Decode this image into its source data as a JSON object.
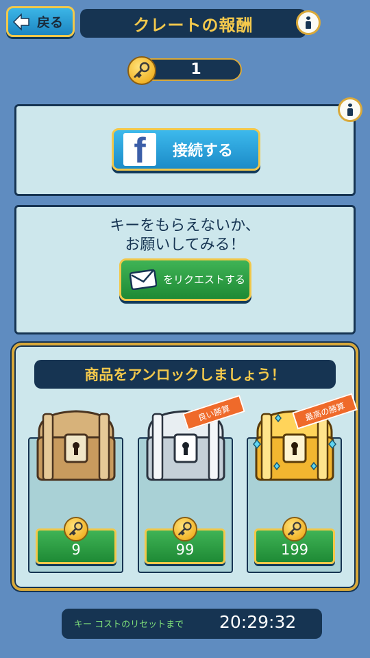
{
  "header": {
    "back_label": "戻る",
    "title": "クレートの報酬",
    "info_icon": "info-icon"
  },
  "keys": {
    "count": "1",
    "icon": "key-icon"
  },
  "facebook": {
    "connect_label": "接続する",
    "icon": "facebook-icon"
  },
  "request": {
    "message_line1": "キーをもらえないか、",
    "message_line2": "お願いしてみる！",
    "button_label": "をリクエストする",
    "icon": "envelope-icon"
  },
  "shop": {
    "title": "商品をアンロックしましょう！",
    "items": [
      {
        "name": "wooden-chest",
        "price": "9",
        "ribbon": ""
      },
      {
        "name": "silver-chest",
        "price": "99",
        "ribbon": "良い勝算"
      },
      {
        "name": "gold-chest",
        "price": "199",
        "ribbon": "最高の勝算"
      }
    ]
  },
  "timer": {
    "label": "キー コストのリセットまで",
    "value": "20:29:32"
  },
  "colors": {
    "background": "#5f8cc0",
    "navy": "#163452",
    "gold": "#f4c94c",
    "panel": "#cde7ec",
    "blue_button": "#1d86c2",
    "green_button": "#1e8a35",
    "ribbon": "#ef6a2a"
  }
}
